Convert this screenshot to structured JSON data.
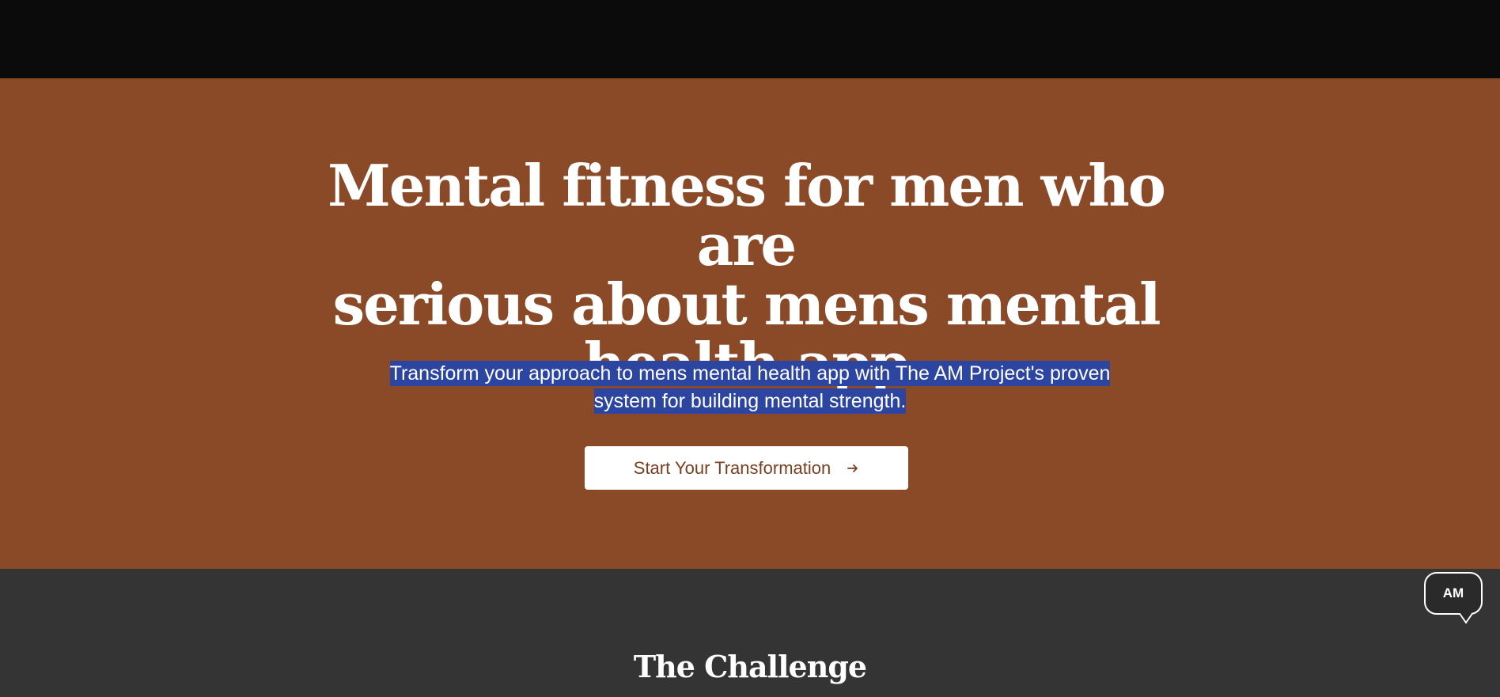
{
  "hero": {
    "title_lines": [
      "Mental fitness for men who are",
      "serious about mens mental",
      "health app"
    ],
    "subtitle_lines": [
      "Transform your approach to mens mental health app with The AM Project's proven",
      "system for building mental strength."
    ],
    "cta_label": "Start Your Transformation",
    "cta_icon": "arrow-right-icon"
  },
  "challenge": {
    "title": "The Challenge"
  },
  "chat_widget": {
    "label": "AM",
    "icon": "chat-bubble-icon"
  },
  "colors": {
    "top_bar": "#0b0b0b",
    "hero_background": "#8b4a27",
    "text_selection": "#2c45a0",
    "button_background": "#ffffff",
    "button_text": "#7a3f20",
    "section_background": "#343434"
  }
}
